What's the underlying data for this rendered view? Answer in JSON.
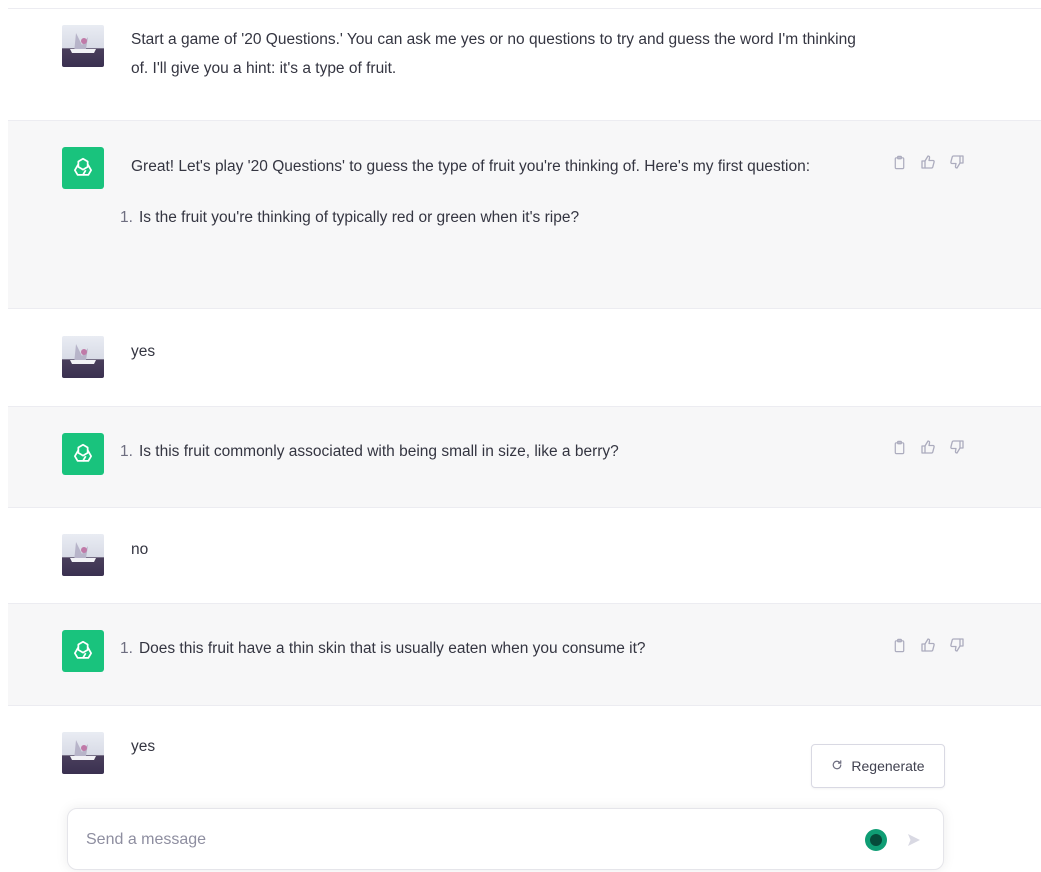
{
  "conversation": {
    "m1": {
      "role": "user",
      "text": "Start a game of '20 Questions.' You can ask me yes or no questions to try and guess the word I'm thinking of. I'll give you a hint: it's a type of fruit."
    },
    "m2": {
      "role": "assistant",
      "intro": "Great! Let's play '20 Questions' to guess the type of fruit you're thinking of. Here's my first question:",
      "list_number": "1.",
      "list_text": "Is the fruit you're thinking of typically red or green when it's ripe?"
    },
    "m3": {
      "role": "user",
      "text": "yes"
    },
    "m4": {
      "role": "assistant",
      "list_number": "1.",
      "list_text": "Is this fruit commonly associated with being small in size, like a berry?"
    },
    "m5": {
      "role": "user",
      "text": "no"
    },
    "m6": {
      "role": "assistant",
      "list_number": "1.",
      "list_text": "Does this fruit have a thin skin that is usually eaten when you consume it?"
    },
    "m7": {
      "role": "user",
      "text": "yes"
    }
  },
  "icons": {
    "user_avatar": "user-avatar",
    "assistant_avatar": "openai-logo-icon",
    "copy": "clipboard-icon",
    "thumbs_up": "thumbs-up-icon",
    "thumbs_down": "thumbs-down-icon",
    "regenerate": "refresh-icon",
    "send": "send-icon",
    "grammar": "grammarly-icon"
  },
  "regenerate": {
    "label": "Regenerate"
  },
  "composer": {
    "placeholder": "Send a message",
    "value": ""
  },
  "colors": {
    "assistant_bg": "#f7f7f8",
    "logo_green": "#19c37d",
    "text": "#343541"
  }
}
